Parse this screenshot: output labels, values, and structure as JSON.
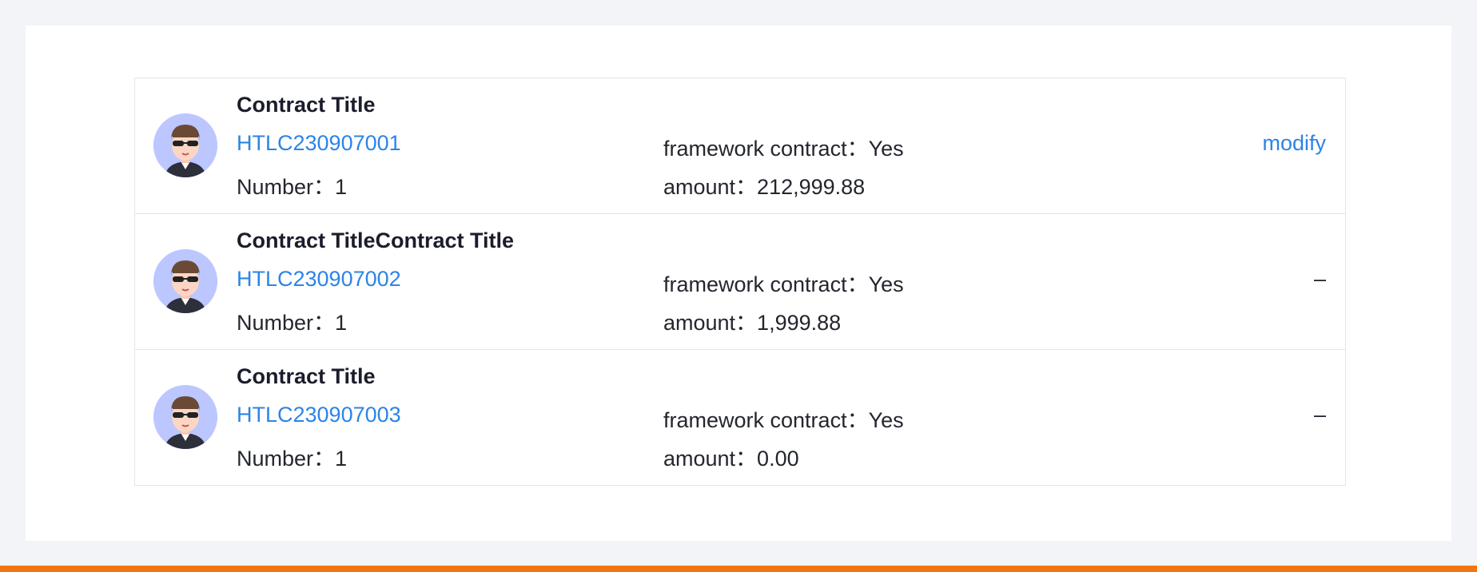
{
  "contracts": [
    {
      "title": "Contract Title",
      "code": "HTLC230907001",
      "number": "Number：1",
      "framework": "framework contract：Yes",
      "amount": "amount：212,999.88",
      "action": "modify"
    },
    {
      "title": "Contract TitleContract Title",
      "code": "HTLC230907002",
      "number": "Number：1",
      "framework": "framework contract：Yes",
      "amount": "amount：1,999.88",
      "action": "–"
    },
    {
      "title": "Contract Title",
      "code": "HTLC230907003",
      "number": "Number：1",
      "framework": "framework contract：Yes",
      "amount": "amount：0.00",
      "action": "–"
    }
  ],
  "colors": {
    "link": "#2c84e6",
    "text": "#24262f",
    "accent_bar": "#f27413",
    "avatar_bg": "#bcc6ff"
  },
  "icons": {
    "avatar": "cartoon-person-with-sunglasses-avatar"
  }
}
